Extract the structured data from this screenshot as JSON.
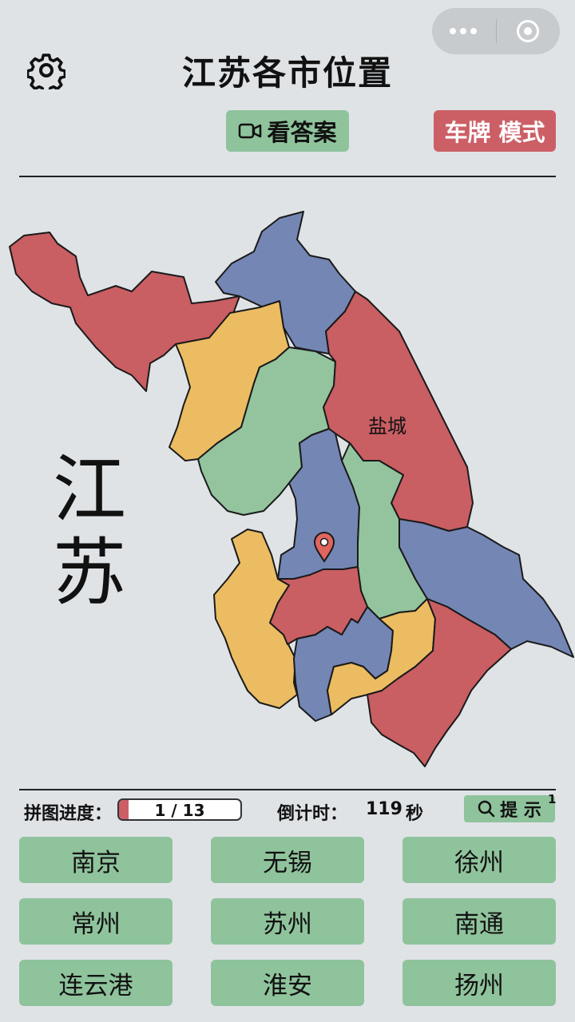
{
  "header": {
    "title": "江苏各市位置"
  },
  "toolbar": {
    "answer_label": "看答案",
    "mode_label": "车牌 模式"
  },
  "map": {
    "province_label_line1": "江",
    "province_label_line2": "苏",
    "placed_city_label": "盐城",
    "colors": {
      "red": "#c95e63",
      "blue": "#7486b4",
      "yellow": "#ecbc62",
      "green": "#93c49e"
    }
  },
  "status": {
    "progress_label": "拼图进度：",
    "progress_text": "1 / 13",
    "progress_fraction": 0.0769,
    "timer_label": "倒计时：",
    "timer_value": "119",
    "timer_unit": "秒",
    "hint_label": "提 示",
    "hint_count": "1"
  },
  "cities": [
    "南京",
    "无锡",
    "徐州",
    "常州",
    "苏州",
    "南通",
    "连云港",
    "淮安",
    "扬州"
  ],
  "theme": {
    "background": "#dfe3e6",
    "button_green": "#8fc39c",
    "button_red": "#cc5f66"
  }
}
